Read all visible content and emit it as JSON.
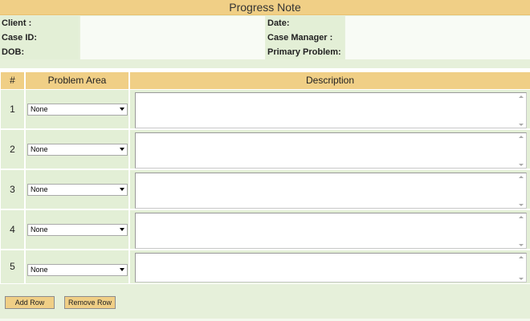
{
  "title": "Progress Note",
  "info": {
    "client_label": "Client :",
    "date_label": "Date:",
    "case_id_label": "Case ID:",
    "case_manager_label": "Case Manager :",
    "dob_label": "DOB:",
    "primary_problem_label": "Primary Problem:"
  },
  "table": {
    "headers": {
      "num": "#",
      "problem_area": "Problem Area",
      "description": "Description"
    },
    "rows": [
      {
        "num": "1",
        "problem_area": "None",
        "description": ""
      },
      {
        "num": "2",
        "problem_area": "None",
        "description": ""
      },
      {
        "num": "3",
        "problem_area": "None",
        "description": ""
      },
      {
        "num": "4",
        "problem_area": "None",
        "description": ""
      },
      {
        "num": "5",
        "problem_area": "None",
        "description": ""
      }
    ]
  },
  "buttons": {
    "add_row": "Add Row",
    "remove_row": "Remove Row"
  },
  "colors": {
    "header": "#f0cf86",
    "cell": "#e3efd6",
    "field": "#f8fbf5"
  }
}
